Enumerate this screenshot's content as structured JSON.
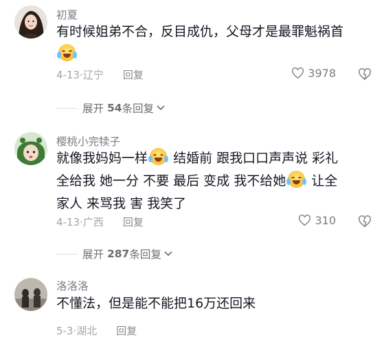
{
  "comments": [
    {
      "username": "初夏",
      "text_parts": [
        "有时候姐弟不合，反目成仇，父母才是最罪魁祸首"
      ],
      "emoji": "crying-laughing-emoji",
      "date": "4-13",
      "location": "辽宁",
      "reply_label": "回复",
      "likes": "3978",
      "expand_label": "展开",
      "expand_count": "54",
      "expand_suffix": "条回复"
    },
    {
      "username": "樱桃小完犊子",
      "text_parts": [
        "就像我妈妈一样",
        "结婚前 跟我口口声声说 彩礼",
        "全给我  她一分 不要  最后 变成 我不给她",
        "让全",
        "家人 来骂我    害 我笑了"
      ],
      "emoji": "crying-laughing-emoji",
      "date": "4-13",
      "location": "广西",
      "reply_label": "回复",
      "likes": "310",
      "expand_label": "展开",
      "expand_count": "287",
      "expand_suffix": "条回复"
    },
    {
      "username": "洛洛洛",
      "text_parts": [
        "不懂法，但是能不能把16万还回来"
      ],
      "date": "5-3",
      "location": "湖北",
      "reply_label": "回复"
    }
  ],
  "colors": {
    "text": "#161823",
    "muted": "#a4a5ab",
    "name": "#7b7b83"
  }
}
